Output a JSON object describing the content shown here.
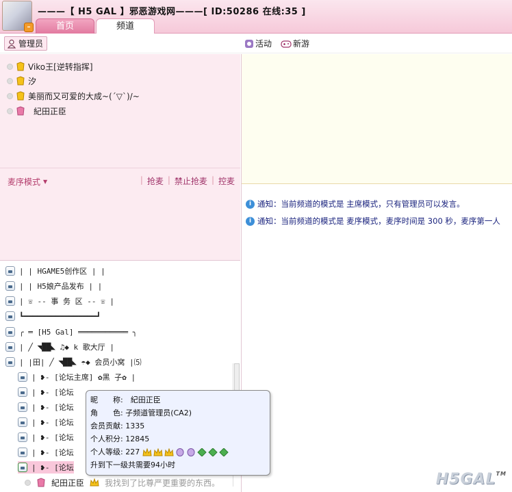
{
  "header": {
    "title": "———【 H5 GAL 】邪恶游戏网———[ ID:50286 在线:35 ]",
    "tabs": [
      {
        "label": "首页"
      },
      {
        "label": "频道"
      }
    ]
  },
  "toolbar": {
    "admin": "管理员",
    "activity": "活动",
    "new_game": "新游"
  },
  "users": [
    {
      "name": "Viko王[逆转指挥]"
    },
    {
      "name": "汐"
    },
    {
      "name": "美丽而又可爱的大成~(´▽`)/~"
    },
    {
      "name": "紀田正臣"
    }
  ],
  "mic": {
    "mode": "麦序模式",
    "grab": "抢麦",
    "forbid": "禁止抢麦",
    "control": "控麦"
  },
  "channels": [
    "|        | HGAME5创作区  |        |",
    "|        | H5娘产品发布  |        |",
    "|    ☏  -- 事 务 区 --  ☏    |",
    "┗━━━━━━━━━━━━━━━━┛",
    "╭ ═ [H5 Gal] ═══════════ ╮",
    "|  ╱ ◥██◣      ♫◆   k 歌大厅  |",
    "| |田| ╱ ◥██◣  ☂◆  会员小窝  |⑸",
    "|  ❥-  [论坛主席]  ✿黑  子✿  |",
    "|  ❥-  [论坛",
    "|  ❥-  [论坛",
    "|  ❥-  [论坛",
    "|  ❥-  [论坛",
    "|  ❥-  [论坛",
    "|  ❥-  [论坛"
  ],
  "notices": [
    "通知：当前频道的模式是 主席模式，只有管理员可以发言。",
    "通知：当前频道的模式是 麦序模式，麦序时间是 300 秒，麦序第一人"
  ],
  "notice_icon": "i",
  "tooltip": {
    "nick": "昵　　称:　紀田正臣",
    "role": "角　　色: 子频道管理员(CA2)",
    "contrib": "会员贡献: 1335",
    "points": "个人积分: 12845",
    "level": "个人等级: 227",
    "upgrade": "升到下一级共需要94小时"
  },
  "bottom_user": {
    "name": "紀田正臣",
    "sign": "我找到了比尊严更重要的东西。"
  },
  "logo": {
    "text": "H5GAL",
    "tm": "TM"
  },
  "colors": {
    "accent": "#e27aa0",
    "notice": "#1a237e",
    "pink_bg": "#fcebf1"
  }
}
